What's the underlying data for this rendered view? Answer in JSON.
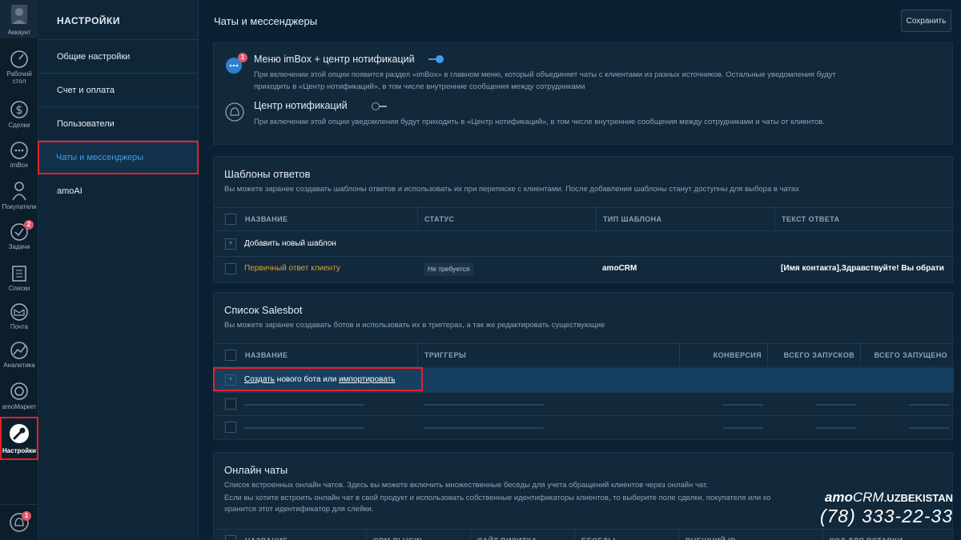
{
  "rail": {
    "account": "Аккаунт",
    "dashboard": "Рабочий стол",
    "leads": "Сделки",
    "imbox": "imBox",
    "customers": "Покупатели",
    "tasks": "Задачи",
    "tasks_badge": "2",
    "lists": "Списки",
    "mail": "Почта",
    "analytics": "Аналитика",
    "market": "amoМаркет",
    "settings": "Настройки",
    "bottom_badge": "1"
  },
  "menu": {
    "title": "НАСТРОЙКИ",
    "items": [
      "Общие настройки",
      "Счет и оплата",
      "Пользователи",
      "Чаты и мессенджеры",
      "amoAI"
    ]
  },
  "page": {
    "title": "Чаты и мессенджеры",
    "save_label": "Сохранить"
  },
  "notifications": {
    "imbox_badge": "1",
    "option1_title": "Меню imBox + центр нотификаций",
    "option1_desc_line1": "При включении этой опции появится раздел «imBox» в главном меню, который объединяет чаты с клиентами из разных источников. Остальные уведомления будут",
    "option1_desc_line2": "приходить в «Центр нотификаций», в том числе внутренние сообщения между сотрудниками",
    "option2_title": "Центр нотификаций",
    "option2_desc": "При включении этой опции уведомления будут приходить в «Центр нотификаций», в том числе внутренние сообщения между сотрудниками и чаты от клиентов.",
    "option1_enabled": true,
    "option2_enabled": false
  },
  "templates": {
    "title": "Шаблоны ответов",
    "desc": "Вы можете заранее создавать шаблоны ответов и использовать их при переписке с клиентами. После добавления шаблоны станут доступны для выбора в чатах",
    "columns": [
      "НАЗВАНИЕ",
      "СТАТУС",
      "ТИП ШАБЛОНА",
      "ТЕКСТ ОТВЕТА"
    ],
    "add_label": "Добавить новый шаблон",
    "rows": [
      {
        "name": "Первичный ответ клиенту",
        "status": "Не требуется",
        "type": "amoCRM",
        "text": "[Имя контакта],Здравствуйте! Вы обрати"
      }
    ]
  },
  "salesbot": {
    "title": "Список Salesbot",
    "desc": "Вы можете заранее создавать ботов и использовать их в триггерах, а так же редактировать существующие",
    "columns": [
      "НАЗВАНИЕ",
      "ТРИГГЕРЫ",
      "КОНВЕРСИЯ",
      "ВСЕГО ЗАПУСКОВ",
      "ВСЕГО ЗАПУЩЕНО"
    ],
    "create_link": "Создать",
    "create_middle": " нового бота или ",
    "import_link": "импортировать"
  },
  "online_chats": {
    "title": "Онлайн чаты",
    "desc_line1": "Список встроенных онлайн чатов. Здесь вы можете включить множественные беседы для учета обращений клиентов через онлайн чат.",
    "desc_line2": "Если вы хотите встроить онлайн чат в свой продукт и использовать собственные идентификаторы клиентов, то выберите поле сделки, покупателя или ко",
    "desc_line3": "хранится этот идентификатор для слейки.",
    "columns": [
      "НАЗВАНИЕ",
      "CRM PLUGIN",
      "САЙТ ВИЗИТКА",
      "БЕСЕДЫ",
      "ВНЕШНИЙ ID",
      "КОД ДЛЯ ВСТАВКИ"
    ]
  },
  "watermark": {
    "brand_a": "amo",
    "brand_b": "CRM",
    "country": ".UZBEKISTAN",
    "phone": "(78) 333-22-33"
  },
  "colors": {
    "accent": "#3d9cf0",
    "highlight_outline": "#e5202a",
    "template_name": "#e0a030",
    "badge": "#e05567"
  }
}
